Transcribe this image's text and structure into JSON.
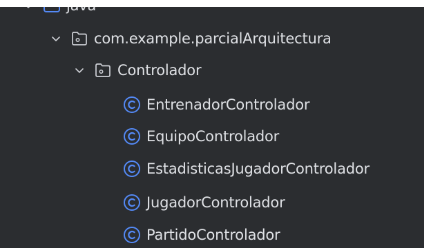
{
  "colors": {
    "panel_bg": "#2b2d30",
    "text": "#dfe1e5",
    "folder_icon_stroke": "#ced0d6",
    "source_folder_icon": "#548af7",
    "class_icon": "#548af7"
  },
  "tree": {
    "source_root": {
      "label": "java",
      "icon": "source-folder-icon",
      "expanded": true
    },
    "package": {
      "label": "com.example.parcialArquitectura",
      "icon": "package-icon",
      "expanded": true
    },
    "subpackage": {
      "label": "Controlador",
      "icon": "package-icon",
      "expanded": true
    },
    "classes": [
      {
        "label": "EntrenadorControlador",
        "icon": "class-icon"
      },
      {
        "label": "EquipoControlador",
        "icon": "class-icon"
      },
      {
        "label": "EstadisticasJugadorControlador",
        "icon": "class-icon"
      },
      {
        "label": "JugadorControlador",
        "icon": "class-icon"
      },
      {
        "label": "PartidoControlador",
        "icon": "class-icon"
      }
    ]
  }
}
